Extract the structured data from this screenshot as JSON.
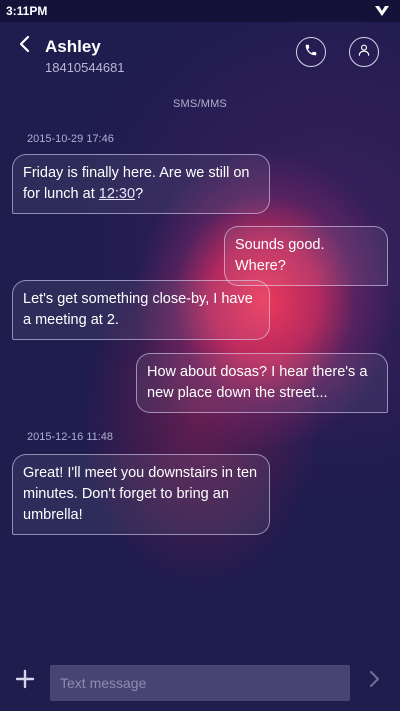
{
  "status_bar": {
    "time": "3:11PM",
    "icon": "signal-icon"
  },
  "header": {
    "back_icon": "back-arrow-icon",
    "contact_name": "Ashley",
    "contact_number": "18410544681",
    "call_icon": "phone-icon",
    "profile_icon": "person-icon"
  },
  "thread": {
    "channel_label": "SMS/MMS",
    "timestamps": [
      "2015-10-29 17:46",
      "2015-12-16 11:48"
    ],
    "messages": [
      {
        "direction": "incoming",
        "text_before_link": "Friday is finally here. Are we still on for lunch at ",
        "link_text": "12:30",
        "text_after_link": "?"
      },
      {
        "direction": "outgoing",
        "text": "Sounds good. Where?"
      },
      {
        "direction": "incoming",
        "text": "Let's get something close-by, I have a meeting at 2."
      },
      {
        "direction": "outgoing",
        "text": "How about dosas? I hear there's a new place down the street..."
      },
      {
        "direction": "incoming",
        "text": "Great! I'll meet you downstairs in ten minutes. Don't forget to bring an umbrella!"
      }
    ]
  },
  "compose": {
    "add_icon": "plus-icon",
    "placeholder": "Text message",
    "value": "",
    "send_icon": "send-chevron-icon"
  },
  "colors": {
    "background": "#1f1c4e",
    "glow": "#f43a5c",
    "bubble_border": "#e6e1ff",
    "secondary_text": "#aeb0d2"
  }
}
